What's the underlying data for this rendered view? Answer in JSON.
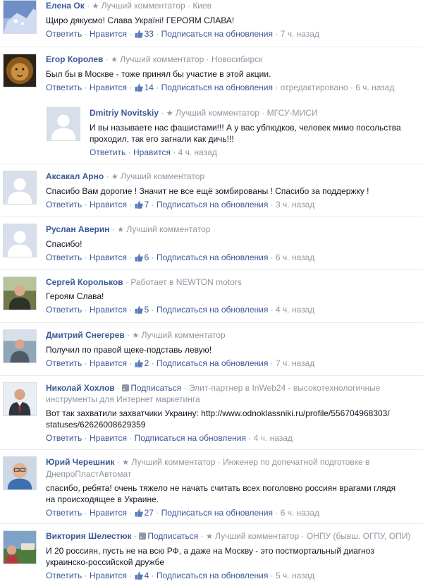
{
  "comments": [
    {
      "author": "Елена Ок",
      "badge": "Лучший комментатор",
      "info": "Киев",
      "text": "Щиро дякуємо! Слава Україні! ГЕРОЯМ СЛАВА!",
      "likes": "33",
      "time": "7 ч. назад"
    },
    {
      "author": "Егор Королев",
      "badge": "Лучший комментатор",
      "info": "Новосибирск",
      "text": "Был бы в Москве - тоже принял бы участие в этой акции.",
      "likes": "14",
      "edited": "отредактировано",
      "time": "6 ч. назад"
    },
    {
      "author": "Dmitriy Novitskiy",
      "badge": "Лучший комментатор",
      "info": "МГСУ-МИСИ",
      "text_lines": [
        "И вы называете нас фашистами!!! А у вас ублюдков, человек мимо посольства",
        "проходил, так его загнали как дичь!!!"
      ],
      "time": "4 ч. назад"
    },
    {
      "author": "Аксакал Арно",
      "badge": "Лучший комментатор",
      "text": "Спасибо Вам дорогие ! Значит не все ещё зомбированы ! Спасибо за поддержку !",
      "likes": "7",
      "time": "3 ч. назад"
    },
    {
      "author": "Руслан Аверин",
      "badge": "Лучший комментатор",
      "text": "Спасибо!",
      "likes": "6",
      "time": "6 ч. назад"
    },
    {
      "author": "Сергей Корольков",
      "info": "Работает в NEWTON motors",
      "text": "Героям Слава!",
      "likes": "5",
      "time": "4 ч. назад"
    },
    {
      "author": "Дмитрий Снегерев",
      "badge": "Лучший комментатор",
      "text": "Получил по правой щеке-подставь левую!",
      "likes": "2",
      "time": "7 ч. назад"
    },
    {
      "author": "Николай Хохлов",
      "subscribe": "Подписаться",
      "info_lines": [
        "Элит-партнер в InWeb24 - высокотехнологичные",
        "инструменты для Интернет маркетинга"
      ],
      "text_lines": [
        "Вот так захватили захватчики Украину: http://www.odnoklassniki.ru/profile/556704968303/",
        "statuses/62626008629359"
      ],
      "time": "4 ч. назад"
    },
    {
      "author": "Юрий Черешник",
      "badge": "Лучший комментатор",
      "info_lines": [
        "Инженер по допечатной подготовке в",
        "ДнепроПластАвтомат"
      ],
      "text_lines": [
        "спасибо, ребята! очень тяжело не начать считать всех поголовно россиян врагами глядя",
        "на происходящее в Украине."
      ],
      "likes": "27",
      "time": "6 ч. назад"
    },
    {
      "author": "Виктория Шелестюк",
      "subscribe": "Подписаться",
      "badge": "Лучший комментатор",
      "info": "ОНПУ (бывш. ОГПУ, ОПИ)",
      "text_lines": [
        "И 20 россиян, пусть не на всю РФ, а даже на Москву - это постмортальный диагноз",
        "украинско-российской дружбе"
      ],
      "likes": "4",
      "time": "5 ч. назад"
    }
  ],
  "actions": {
    "reply": "Ответить",
    "like": "Нравится",
    "subscribe_updates": "Подписаться на обновления"
  },
  "icons": {
    "like": "thumbs-up-icon",
    "badge": "star-icon",
    "subscribe": "rss-icon"
  },
  "colors": {
    "link": "#3b5998",
    "meta": "#9197a3",
    "text": "#141823"
  }
}
